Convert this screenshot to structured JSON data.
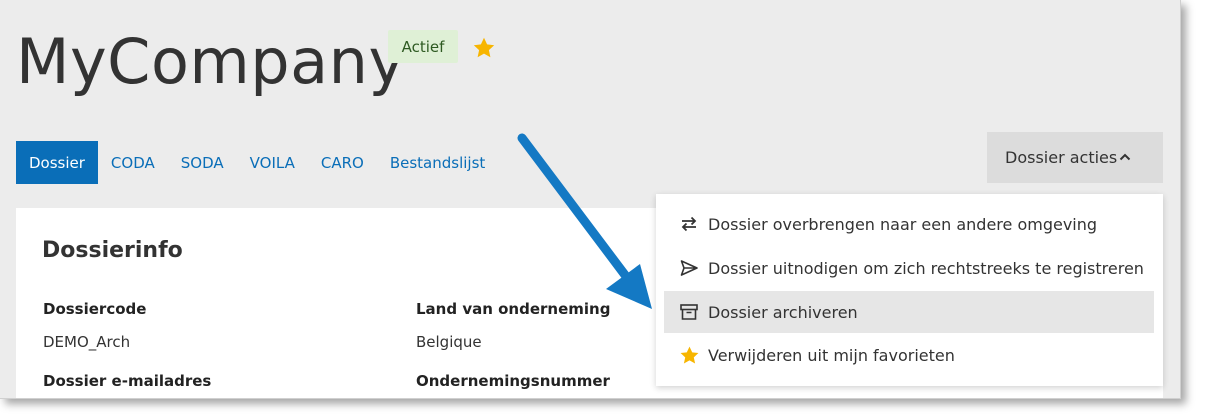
{
  "company": {
    "name": "MyCompany",
    "status": "Actief",
    "favorite_icon": "star-icon",
    "star_color": "#f7b500"
  },
  "tabs": [
    {
      "label": "Dossier",
      "active": true
    },
    {
      "label": "CODA",
      "active": false
    },
    {
      "label": "SODA",
      "active": false
    },
    {
      "label": "VOILA",
      "active": false
    },
    {
      "label": "CARO",
      "active": false
    },
    {
      "label": "Bestandslijst",
      "active": false
    }
  ],
  "actions": {
    "label": "Dossier acties",
    "icon": "chevron-up-icon",
    "menu": [
      {
        "label": "Dossier overbrengen naar een andere omgeving",
        "icon": "transfer-icon"
      },
      {
        "label": "Dossier uitnodigen om zich rechtstreeks te registreren",
        "icon": "send-icon"
      },
      {
        "label": "Dossier archiveren",
        "icon": "archive-icon",
        "highlighted": true
      },
      {
        "label": "Verwijderen uit mijn favorieten",
        "icon": "star-icon"
      }
    ]
  },
  "dossierinfo": {
    "title": "Dossierinfo",
    "fields": [
      {
        "label": "Dossiercode",
        "value": "DEMO_Arch"
      },
      {
        "label": "Land van onderneming",
        "value": "Belgique"
      },
      {
        "label": "Dossier e-mailadres",
        "value": ""
      },
      {
        "label": "Ondernemingsnummer",
        "value": ""
      }
    ]
  },
  "colors": {
    "accent": "#0a6eb8",
    "badge_bg": "#dff0d6",
    "menu_hover": "#e6e6e6",
    "annotation_arrow": "#1479c4"
  }
}
